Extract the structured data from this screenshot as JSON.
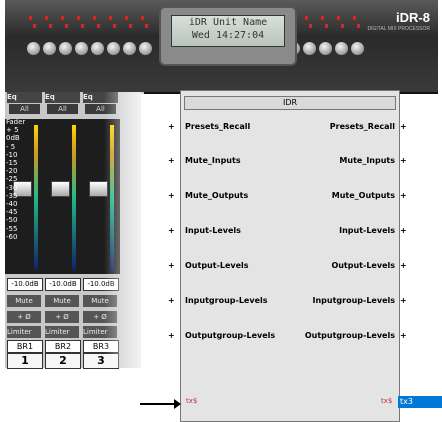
{
  "device": {
    "lcd_line1": "iDR Unit Name",
    "lcd_line2": "Wed 14:27:04",
    "brand": "iDR-8",
    "brand_sub": "DIGITAL MIX PROCESSOR"
  },
  "mixer": {
    "scale_title": "Fader",
    "scale_labels": [
      "+ 5",
      "0dB",
      "- 5",
      "-10",
      "-15",
      "-20",
      "-25",
      "-30",
      "-35",
      "-40",
      "-45",
      "-50",
      "-55",
      "-60"
    ],
    "strips": [
      {
        "eq_label": "Eq",
        "all_label": "All",
        "value": "-10.0dB",
        "mute": "Mute",
        "phase": "+ Ø",
        "limiter": "Limiter",
        "name": "BR1",
        "number": "1"
      },
      {
        "eq_label": "Eq",
        "all_label": "All",
        "value": "-10.0dB",
        "mute": "Mute",
        "phase": "+ Ø",
        "limiter": "Limiter",
        "name": "BR2",
        "number": "2"
      },
      {
        "eq_label": "Eq",
        "all_label": "All",
        "value": "-10.0dB",
        "mute": "Mute",
        "phase": "+ Ø",
        "limiter": "Limiter",
        "name": "BR3",
        "number": "3"
      }
    ]
  },
  "idr_panel": {
    "title": "IDR",
    "ports": [
      {
        "left": "Presets_Recall",
        "right": "Presets_Recall"
      },
      {
        "left": "Mute_Inputs",
        "right": "Mute_Inputs"
      },
      {
        "left": "Mute_Outputs",
        "right": "Mute_Outputs"
      },
      {
        "left": "Input-Levels",
        "right": "Input-Levels"
      },
      {
        "left": "Output-Levels",
        "right": "Output-Levels"
      },
      {
        "left": "Inputgroup-Levels",
        "right": "Inputgroup-Levels"
      },
      {
        "left": "Outputgroup-Levels",
        "right": "Outputgroup-Levels"
      }
    ],
    "plus_symbol": "+",
    "tx_left": "tx$",
    "tx_right": "tx$",
    "tx_tag": "tx3"
  },
  "colors": {
    "selection_blue": "#0078d7",
    "tx_red": "#b33333",
    "panel_gray": "#e4e4e4"
  }
}
